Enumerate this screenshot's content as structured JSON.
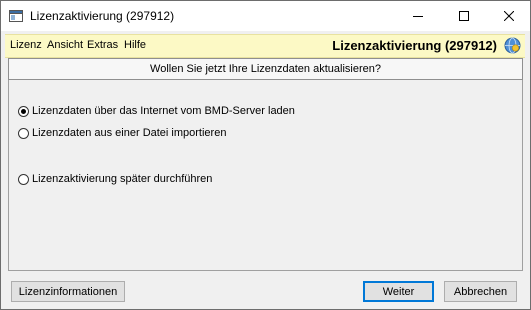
{
  "window": {
    "title": "Lizenzaktivierung (297912)"
  },
  "menu": {
    "items": [
      {
        "label": "Lizenz"
      },
      {
        "label": "Ansicht"
      },
      {
        "label": "Extras"
      },
      {
        "label": "Hilfe"
      }
    ],
    "header_title": "Lizenzaktivierung (297912)"
  },
  "question": "Wollen Sie jetzt Ihre Lizenzdaten aktualisieren?",
  "options": [
    {
      "label": "Lizenzdaten über das Internet vom BMD-Server laden",
      "selected": true
    },
    {
      "label": "Lizenzdaten aus einer Datei importieren",
      "selected": false
    },
    {
      "label": "Lizenzaktivierung später durchführen",
      "selected": false
    }
  ],
  "buttons": {
    "info": "Lizenzinformationen",
    "next": "Weiter",
    "cancel": "Abbrechen"
  },
  "colors": {
    "menubar_bg": "#fcf9c5",
    "accent": "#0078d7"
  },
  "icons": {
    "app": "app-window-icon",
    "help": "help-globe-icon"
  }
}
